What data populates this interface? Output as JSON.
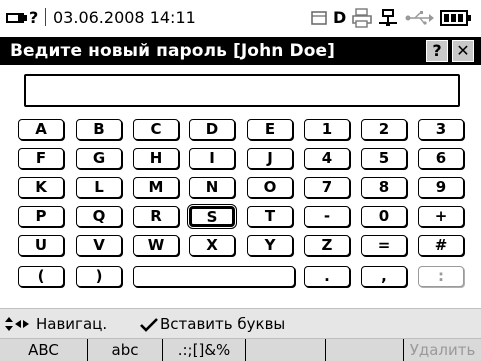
{
  "status_bar": {
    "date_time": "03.06.2008  14:11",
    "indicator": "?",
    "drive_letter": "D",
    "icons": [
      "battery-low-icon",
      "card-icon",
      "printer-icon",
      "network-icon",
      "usb-icon",
      "battery-icon"
    ]
  },
  "title_bar": {
    "title": "Ведите новый пароль [John Doe]",
    "help_label": "?",
    "close_label": "✕"
  },
  "password_input": {
    "value": ""
  },
  "keyboard": {
    "selected_key": "S",
    "rows": [
      [
        "A",
        "B",
        "C",
        "D",
        "E",
        "1",
        "2",
        "3"
      ],
      [
        "F",
        "G",
        "H",
        "I",
        "J",
        "4",
        "5",
        "6"
      ],
      [
        "K",
        "L",
        "M",
        "N",
        "O",
        "7",
        "8",
        "9"
      ],
      [
        "P",
        "Q",
        "R",
        "S",
        "T",
        "-",
        "0",
        "+"
      ],
      [
        "U",
        "V",
        "W",
        "X",
        "Y",
        "Z",
        "=",
        "#"
      ],
      [
        "(",
        ")",
        " ",
        ".",
        ",",
        ":"
      ]
    ],
    "disabled_keys": [
      ":"
    ]
  },
  "nav_hint": {
    "navigate": "Навигац.",
    "insert": "Вставить буквы"
  },
  "softkeys": [
    {
      "label": "ABC",
      "enabled": true
    },
    {
      "label": "abc",
      "enabled": true
    },
    {
      "label": ".:;[]&%",
      "enabled": true
    },
    {
      "label": "",
      "enabled": true
    },
    {
      "label": "",
      "enabled": true
    },
    {
      "label": "Удалить",
      "enabled": false
    }
  ]
}
